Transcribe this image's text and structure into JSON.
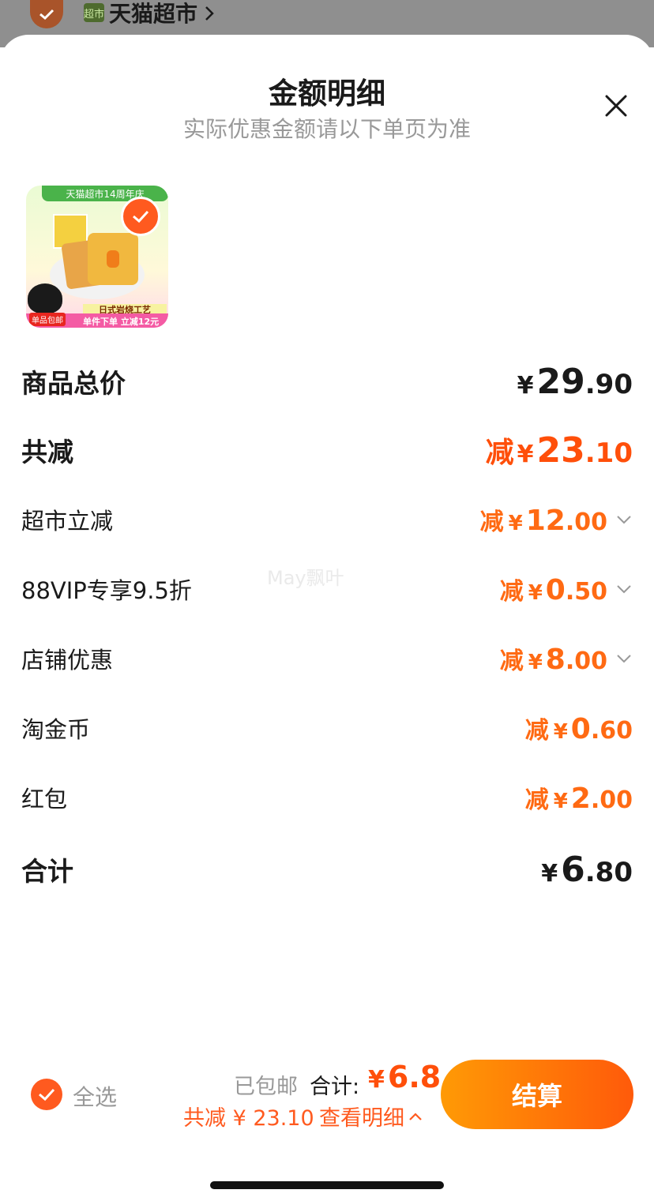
{
  "top": {
    "logo_text": "超市",
    "store_name": "天猫超市"
  },
  "sheet": {
    "title": "金额明细",
    "subtitle": "实际优惠金额请以下单页为准"
  },
  "product": {
    "banner": "天猫超市14周年庆",
    "tag": "日式岩烧工艺",
    "badge": "单品包邮",
    "promo": "单件下单 立减12元"
  },
  "rows": {
    "subtotal": {
      "label": "商品总价",
      "yen": "¥",
      "int": "29",
      "dec": ".90"
    },
    "total_discount": {
      "label": "共减",
      "prefix": "减",
      "yen": "¥",
      "int": "23",
      "dec": ".10"
    },
    "items": [
      {
        "label": "超市立减",
        "prefix": "减",
        "yen": "¥",
        "int": "12",
        "dec": ".00",
        "expandable": true
      },
      {
        "label": "88VIP专享9.5折",
        "prefix": "减",
        "yen": "¥",
        "int": "0",
        "dec": ".50",
        "expandable": true
      },
      {
        "label": "店铺优惠",
        "prefix": "减",
        "yen": "¥",
        "int": "8",
        "dec": ".00",
        "expandable": true
      },
      {
        "label": "淘金币",
        "prefix": "减",
        "yen": "¥",
        "int": "0",
        "dec": ".60",
        "expandable": false
      },
      {
        "label": "红包",
        "prefix": "减",
        "yen": "¥",
        "int": "2",
        "dec": ".00",
        "expandable": false
      }
    ],
    "total": {
      "label": "合计",
      "yen": "¥",
      "int": "6",
      "dec": ".80"
    }
  },
  "watermark": "May飘叶",
  "bottom": {
    "select_all": "全选",
    "shipped": "已包邮",
    "total_label": "合计:",
    "total_yen": "¥",
    "total_value": "6.8",
    "saved": "共减 ¥ 23.10",
    "view_detail": "查看明细",
    "checkout": "结算"
  },
  "colors": {
    "accent": "#ff5a1f",
    "price_orange": "#ff4f0a"
  }
}
